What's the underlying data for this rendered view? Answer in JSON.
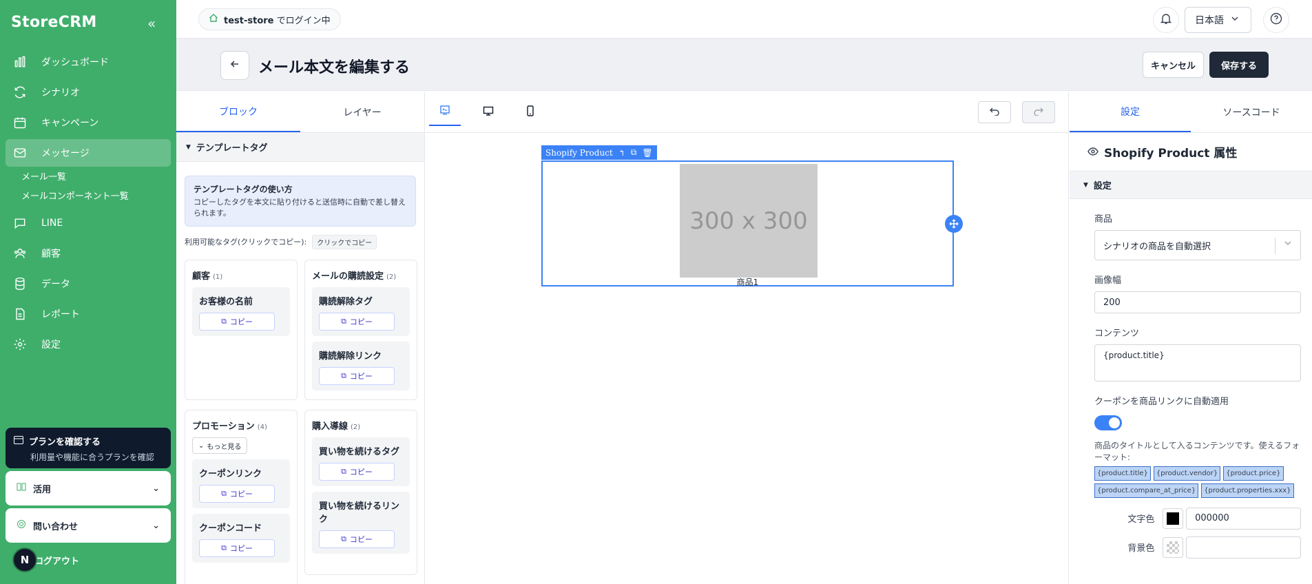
{
  "app": {
    "brand": "StoreCRM"
  },
  "sidebar": {
    "items": [
      {
        "label": "ダッシュボード",
        "icon": "bar-chart-icon"
      },
      {
        "label": "シナリオ",
        "icon": "refresh-icon"
      },
      {
        "label": "キャンペーン",
        "icon": "calendar-icon"
      },
      {
        "label": "メッセージ",
        "icon": "mail-icon",
        "active": true
      },
      {
        "label": "LINE",
        "icon": "chat-icon"
      },
      {
        "label": "顧客",
        "icon": "users-icon"
      },
      {
        "label": "データ",
        "icon": "database-icon"
      },
      {
        "label": "レポート",
        "icon": "report-icon"
      },
      {
        "label": "設定",
        "icon": "gear-icon"
      }
    ],
    "subitems": [
      "メール一覧",
      "メールコンポーネント一覧"
    ],
    "plan": {
      "title": "プランを確認する",
      "subtitle": "利用量や機能に合うプランを確認"
    },
    "usage": "活用",
    "contact": "問い合わせ",
    "logout": "ログアウト",
    "avatar_letter": "N"
  },
  "topbar": {
    "store": "test-store",
    "login_suffix": "でログイン中",
    "language": "日本語"
  },
  "header": {
    "title": "メール本文を編集する",
    "cancel": "キャンセル",
    "save": "保存する"
  },
  "left_panel": {
    "tabs": [
      "ブロック",
      "レイヤー"
    ],
    "section": "テンプレートタグ",
    "info_title": "テンプレートタグの使い方",
    "info_body": "コピーしたタグを本文に貼り付けると送信時に自動で差し替えられます。",
    "available_label": "利用可能なタグ(クリックでコピー):",
    "copy_chip": "クリックでコピー",
    "copy_label": "コピー",
    "more_label": "もっと見る",
    "groups": [
      {
        "title": "顧客",
        "count": "(1)",
        "items": [
          "お客様の名前"
        ]
      },
      {
        "title": "メールの購読設定",
        "count": "(2)",
        "items": [
          "購読解除タグ",
          "購読解除リンク"
        ]
      },
      {
        "title": "プロモーション",
        "count": "(4)",
        "items": [
          "クーポンリンク",
          "クーポンコード"
        ]
      },
      {
        "title": "購入導線",
        "count": "(2)",
        "items": [
          "買い物を続けるタグ",
          "買い物を続けるリンク"
        ]
      }
    ]
  },
  "canvas": {
    "block_label": "Shopify Product",
    "image_text": "300 x 300",
    "product_caption": "商品1"
  },
  "right_panel": {
    "tabs": [
      "設定",
      "ソースコード"
    ],
    "heading": "Shopify Product 属性",
    "section": "設定",
    "product_label": "商品",
    "product_value": "シナリオの商品を自動選択",
    "image_width_label": "画像幅",
    "image_width_value": "200",
    "content_label": "コンテンツ",
    "content_value": "{product.title}",
    "coupon_label": "クーポンを商品リンクに自動適用",
    "coupon_enabled": true,
    "hint": "商品のタイトルとして入るコンテンツです。使えるフォーマット:",
    "formats": [
      "{product.title}",
      "{product.vendor}",
      "{product.price}",
      "{product.compare_at_price}",
      "{product.properties.xxx}"
    ],
    "text_color_label": "文字色",
    "text_color_value": "000000",
    "bg_color_label": "背景色",
    "bg_color_value": ""
  },
  "colors": {
    "sidebar": "#3fae6b",
    "accent": "#3b82f6",
    "dark": "#1f2937"
  }
}
